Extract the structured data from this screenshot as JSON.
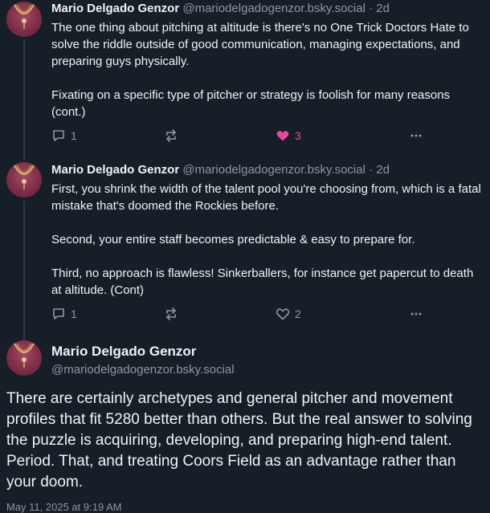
{
  "posts": [
    {
      "author_name": "Mario Delgado Genzor",
      "author_handle": "@mariodelgadogenzor.bsky.social",
      "separator": "·",
      "time": "2d",
      "paragraphs": [
        "The one thing about pitching at altitude is there's no One Trick Doctors Hate to solve the riddle outside of good communication, managing expectations, and preparing guys physically.",
        "Fixating on a specific type of pitcher or strategy is foolish for many reasons (cont.)"
      ],
      "replies": "1",
      "likes": "3",
      "liked": true,
      "icons": [
        "reply-icon",
        "repost-icon",
        "heart-filled-icon",
        "more-icon"
      ]
    },
    {
      "author_name": "Mario Delgado Genzor",
      "author_handle": "@mariodelgadogenzor.bsky.social",
      "separator": "·",
      "time": "2d",
      "paragraphs": [
        "First, you shrink the width of the talent pool you're choosing from, which is a fatal mistake that's doomed the Rockies before.",
        "Second, your entire staff becomes predictable & easy to prepare for.",
        "Third, no approach is flawless! Sinkerballers, for instance get papercut to death at altitude. (Cont)"
      ],
      "replies": "1",
      "likes": "2",
      "liked": false,
      "icons": [
        "reply-icon",
        "repost-icon",
        "heart-outline-icon",
        "more-icon"
      ]
    }
  ],
  "main_post": {
    "author_name": "Mario Delgado Genzor",
    "author_handle": "@mariodelgadogenzor.bsky.social",
    "text": "There are certainly archetypes and general pitcher and movement profiles that fit 5280 better than others. But the real answer to solving the puzzle is acquiring, developing, and preparing high-end talent. Period. That, and treating Coors Field as an advantage rather than your doom.",
    "date": "May 11, 2025 at 9:19 AM"
  },
  "colors": {
    "background": "#161e27",
    "muted": "#8b98a9",
    "like": "#ec4899",
    "text": "#f1f3f5"
  }
}
